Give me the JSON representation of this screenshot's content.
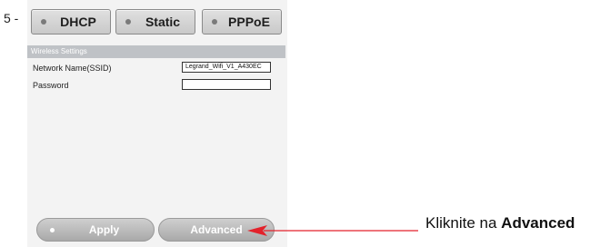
{
  "step_label": "5 -",
  "modes": [
    {
      "label": "DHCP"
    },
    {
      "label": "Static"
    },
    {
      "label": "PPPoE"
    }
  ],
  "section_title": "Wireless Settings",
  "fields": {
    "ssid": {
      "label": "Network Name(SSID)",
      "value": "Legrand_Wifi_V1_A430EC"
    },
    "password": {
      "label": "Password",
      "value": ""
    }
  },
  "buttons": {
    "apply": "Apply",
    "advanced": "Advanced"
  },
  "callout": {
    "prefix": "Kliknite na ",
    "emphasis": "Advanced"
  },
  "colors": {
    "arrow": "#e3222b",
    "section_bar": "#bfc2c6"
  }
}
